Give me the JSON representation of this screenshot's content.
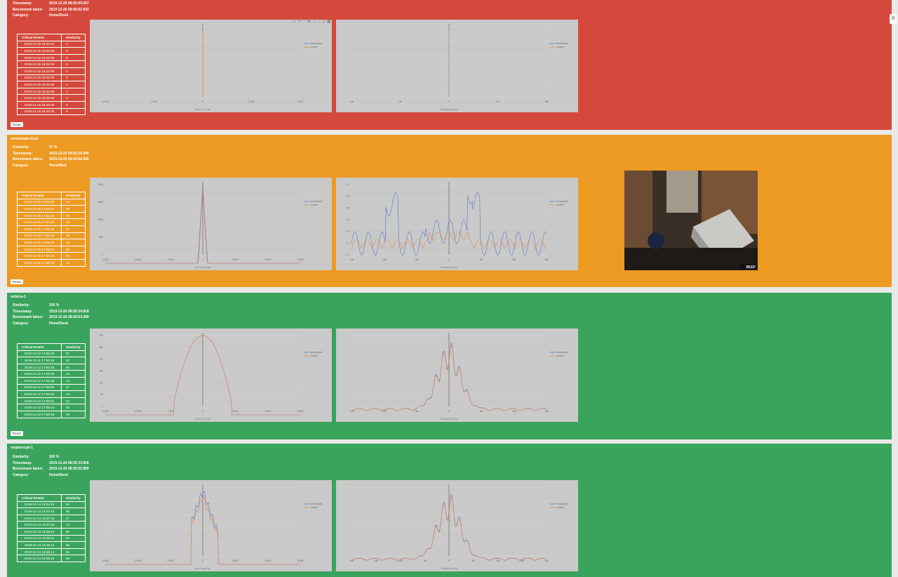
{
  "colors": {
    "red": "#d4493b",
    "orange": "#ed9a22",
    "green": "#3aa45c",
    "benchmark": "#5b78d0",
    "current": "#e8894a"
  },
  "panels": [
    {
      "id": "p1",
      "host": "",
      "color": "red",
      "info": [
        [
          "Timestamp:",
          "2019-12-26 08:55:05.057"
        ],
        [
          "Benchmark taken:",
          "2019-12-26 08:50:52.932"
        ],
        [
          "Category:",
          "Home/Desk"
        ]
      ],
      "events_header": [
        "Critical Events",
        "Similarity"
      ],
      "events": [
        [
          "2019-12-15 15:22:00",
          "0"
        ],
        [
          "2019-12-15 15:22:05",
          "0"
        ],
        [
          "2019-12-15 15:22:06",
          "0"
        ],
        [
          "2019-12-15 15:22:06",
          "0"
        ],
        [
          "2019-12-15 15:22:06",
          "0"
        ],
        [
          "2019-12-15 15:22:06",
          "0"
        ],
        [
          "2019-12-15 15:22:06",
          "0"
        ],
        [
          "2019-12-15 15:22:06",
          "0"
        ],
        [
          "2019-12-15 15:22:06",
          "0"
        ],
        [
          "2019-12-15 15:22:06",
          "0"
        ],
        [
          "2019-12-15 15:22:06",
          "0"
        ]
      ],
      "reset": "Reset",
      "time_ticks": [
        "-0.004",
        "-0.002",
        "0",
        "0.002",
        "0.004"
      ],
      "time_xlabel": "time in sec (s)",
      "freq_ticks": [
        "-10k",
        "-5k",
        "0",
        "5k",
        "10k"
      ],
      "freq_xlabel": "Frequency (Hz)",
      "legend": [
        "benchmark",
        "current"
      ]
    },
    {
      "id": "p2",
      "host": "mochenain.local",
      "color": "orange",
      "info": [
        [
          "Similarity:",
          "67 %"
        ],
        [
          "Timestamp:",
          "2019-12-26 08:55:29.495"
        ],
        [
          "Benchmark taken:",
          "2019-12-26 08:53:06.560"
        ],
        [
          "Category:",
          "Home/Bed"
        ]
      ],
      "events_header": [
        "Critical Events",
        "Similarity"
      ],
      "events": [
        [
          "2019-12-25 17:52:50",
          "64"
        ],
        [
          "2019-12-25 17:52:51",
          "65"
        ],
        [
          "2019-12-25 17:53:16",
          "36"
        ],
        [
          "2019-12-25 17:53:26",
          "36"
        ],
        [
          "2019-12-25 17:55:03",
          "67"
        ],
        [
          "2019-12-25 17:55:06",
          "65"
        ],
        [
          "2019-12-25 17:55:16",
          "36"
        ],
        [
          "2019-12-25 17:55:16",
          "56"
        ],
        [
          "2019-12-25 17:55:16",
          "55"
        ],
        [
          "2019-12-25 17:55:16",
          "44"
        ]
      ],
      "reset": "Reset",
      "time_ticks": [
        "-0.003",
        "-0.002",
        "-0.001",
        "0",
        "0.001",
        "0.002",
        "0.003"
      ],
      "time_xlabel": "time in sec (s)",
      "time_yticks": [
        "2000",
        "1500",
        "1000",
        "500",
        "0"
      ],
      "freq_ticks": [
        "-15k",
        "-10k",
        "-5k",
        "0",
        "5k",
        "10k",
        "15k"
      ],
      "freq_xlabel": "Frequency (Hz)",
      "freq_yticks": [
        "0.7",
        "0.6",
        "0.5",
        "0.4",
        "0.3",
        "0.2",
        "0.1"
      ],
      "legend": [
        "benchmark",
        "current"
      ]
    },
    {
      "id": "p3",
      "host": "nebnca-1",
      "color": "green",
      "info": [
        [
          "Similarity:",
          "100 %"
        ],
        [
          "Timestamp:",
          "2019-12-26 08:55:34.818"
        ],
        [
          "Benchmark taken:",
          "2019-12-26 08:50:54.399"
        ],
        [
          "Category:",
          "Home/Desk"
        ]
      ],
      "events_header": [
        "Critical Events",
        "Similarity"
      ],
      "events": [
        [
          "2019-12-12 17:50:20",
          "57"
        ],
        [
          "2019-12-11 17:50:19",
          "51"
        ],
        [
          "2019-12-12 17:50:35",
          "40"
        ],
        [
          "2019-12-12 17:50:40",
          "44"
        ],
        [
          "2019-12-12 17:56:48",
          "43"
        ],
        [
          "2019-12-12 17:58:53",
          "47"
        ],
        [
          "2019-12-12 17:58:08",
          "40"
        ],
        [
          "2019-12-12 17:59:01",
          "44"
        ],
        [
          "2019-12-12 17:59:10",
          "40"
        ],
        [
          "2019-12-12 17:59:18",
          "46"
        ]
      ],
      "reset": "Reset",
      "time_ticks": [
        "-0.003",
        "-0.002",
        "-0.001",
        "0",
        "0.001",
        "0.002",
        "0.003"
      ],
      "time_xlabel": "time in sec (s)",
      "time_yticks": [
        "300",
        "250",
        "200",
        "150",
        "100",
        "50",
        "0"
      ],
      "freq_ticks": [
        "-15k",
        "-10k",
        "-5k",
        "0",
        "5k",
        "10k",
        "15k"
      ],
      "freq_xlabel": "Frequency (Hz)",
      "legend": [
        "benchmark",
        "current"
      ]
    },
    {
      "id": "p4",
      "host": "raspberrypi-1",
      "color": "green",
      "info": [
        [
          "Similarity:",
          "100 %"
        ],
        [
          "Timestamp:",
          "2019-12-26 08:55:33.856"
        ],
        [
          "Benchmark taken:",
          "2019-12-26 08:50:52.899"
        ],
        [
          "Category:",
          "Home/Desk"
        ]
      ],
      "events_header": [
        "Critical Events",
        "Similarity"
      ],
      "events": [
        [
          "2019-12-14 13:34:19",
          "52"
        ],
        [
          "2019-12-14 13:37:42",
          "55"
        ],
        [
          "2019-12-14 13:37:42",
          "47"
        ],
        [
          "2019-12-14 13:37:42",
          "42"
        ],
        [
          "2019-12-14 13:38:19",
          "60"
        ],
        [
          "2019-12-14 13:38:14",
          "52"
        ],
        [
          "2019-12-14 13:38:11",
          "65"
        ],
        [
          "2019-12-14 13:38:14",
          "68"
        ],
        [
          "2019-12-14 13:38:15",
          "56"
        ]
      ],
      "reset": "Reset",
      "time_ticks": [
        "-0.006",
        "-0.004",
        "-0.002",
        "0",
        "0.002",
        "0.004",
        "0.006"
      ],
      "time_xlabel": "time in sec (s)",
      "freq_ticks": [
        "-20k",
        "-15k",
        "-10k",
        "-5k",
        "0",
        "5k",
        "10k",
        "15k",
        "20k"
      ],
      "freq_xlabel": "Frequency (Hz)",
      "legend": [
        "benchmark",
        "current"
      ]
    }
  ],
  "webcam": {
    "stamp": "BEEF"
  }
}
